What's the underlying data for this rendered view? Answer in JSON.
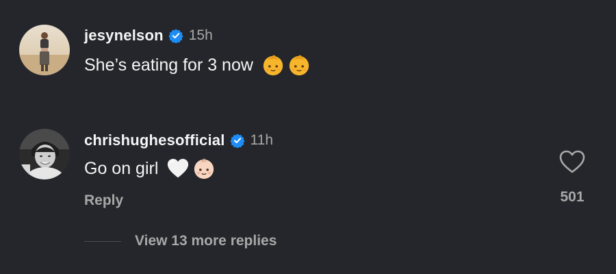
{
  "comments": [
    {
      "username": "jesynelson",
      "time": "15h",
      "text": "She’s eating for 3 now",
      "emojis": [
        "baby-emoji",
        "baby-emoji"
      ]
    },
    {
      "username": "chrishughesofficial",
      "time": "11h",
      "text": "Go on girl",
      "emojis": [
        "white-heart-emoji",
        "baby-emoji"
      ],
      "reply_label": "Reply",
      "like_count": "501"
    }
  ],
  "view_replies_label": "View 13 more replies",
  "colors": {
    "background": "#24262b",
    "text": "#f5f5f5",
    "muted": "#a8a8a8",
    "verified": "#1d8cf5"
  },
  "icons": [
    "verified-badge-icon",
    "heart-outline-icon"
  ]
}
